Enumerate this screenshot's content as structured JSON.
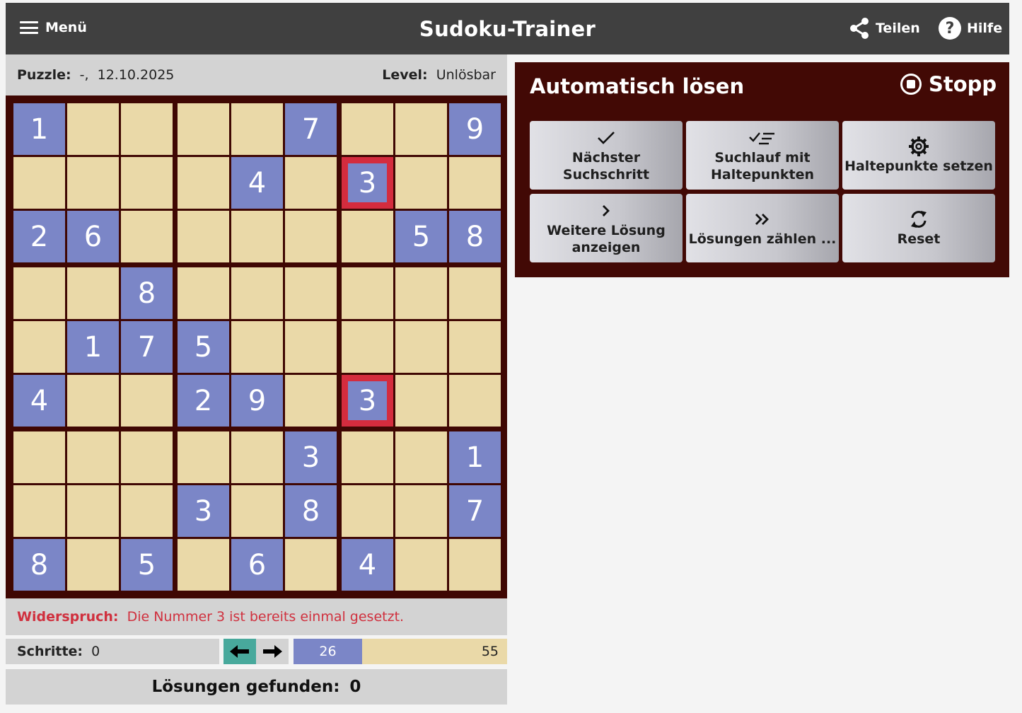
{
  "header": {
    "menu_label": "Menü",
    "title": "Sudoku-Trainer",
    "share_label": "Teilen",
    "help_label": "Hilfe"
  },
  "info": {
    "puzzle_label": "Puzzle:",
    "puzzle_value": "-,  12.10.2025",
    "level_label": "Level:",
    "level_value": "Unlösbar"
  },
  "board": {
    "grid": [
      [
        1,
        0,
        0,
        0,
        0,
        7,
        0,
        0,
        9
      ],
      [
        0,
        0,
        0,
        0,
        4,
        0,
        3,
        0,
        0
      ],
      [
        2,
        6,
        0,
        0,
        0,
        0,
        0,
        5,
        8
      ],
      [
        0,
        0,
        8,
        0,
        0,
        0,
        0,
        0,
        0
      ],
      [
        0,
        1,
        7,
        5,
        0,
        0,
        0,
        0,
        0
      ],
      [
        4,
        0,
        0,
        2,
        9,
        0,
        3,
        0,
        0
      ],
      [
        0,
        0,
        0,
        0,
        0,
        3,
        0,
        0,
        1
      ],
      [
        0,
        0,
        0,
        3,
        0,
        8,
        0,
        0,
        7
      ],
      [
        8,
        0,
        5,
        0,
        6,
        0,
        4,
        0,
        0
      ]
    ],
    "conflicts": [
      [
        1,
        6
      ],
      [
        5,
        6
      ]
    ]
  },
  "status": {
    "contradiction_label": "Widerspruch:",
    "contradiction_text": "Die Nummer 3 ist bereits einmal gesetzt."
  },
  "steps": {
    "label": "Schritte:",
    "value": "0"
  },
  "progress": {
    "filled": 26,
    "empty": 55,
    "filled_label": "26",
    "empty_label": "55"
  },
  "solutions": {
    "label": "Lösungen gefunden:",
    "value": "0"
  },
  "auto": {
    "title": "Automatisch lösen",
    "stop_label": "Stopp",
    "buttons": {
      "next_step": "Nächster Suchschritt",
      "search_breakpoints": "Suchlauf mit Haltepunkten",
      "set_breakpoints": "Haltepunkte setzen",
      "more_solution": "Weitere Lösung anzeigen",
      "count_solutions": "Lösungen zählen ...",
      "reset": "Reset"
    }
  },
  "colors": {
    "header_bg": "#404040",
    "board_border": "#3f0703",
    "given_cell": "#7b86c7",
    "empty_cell": "#ead9a8",
    "conflict": "#d42c3e",
    "arrow_active": "#48a99c",
    "panel_bg": "#420905"
  }
}
